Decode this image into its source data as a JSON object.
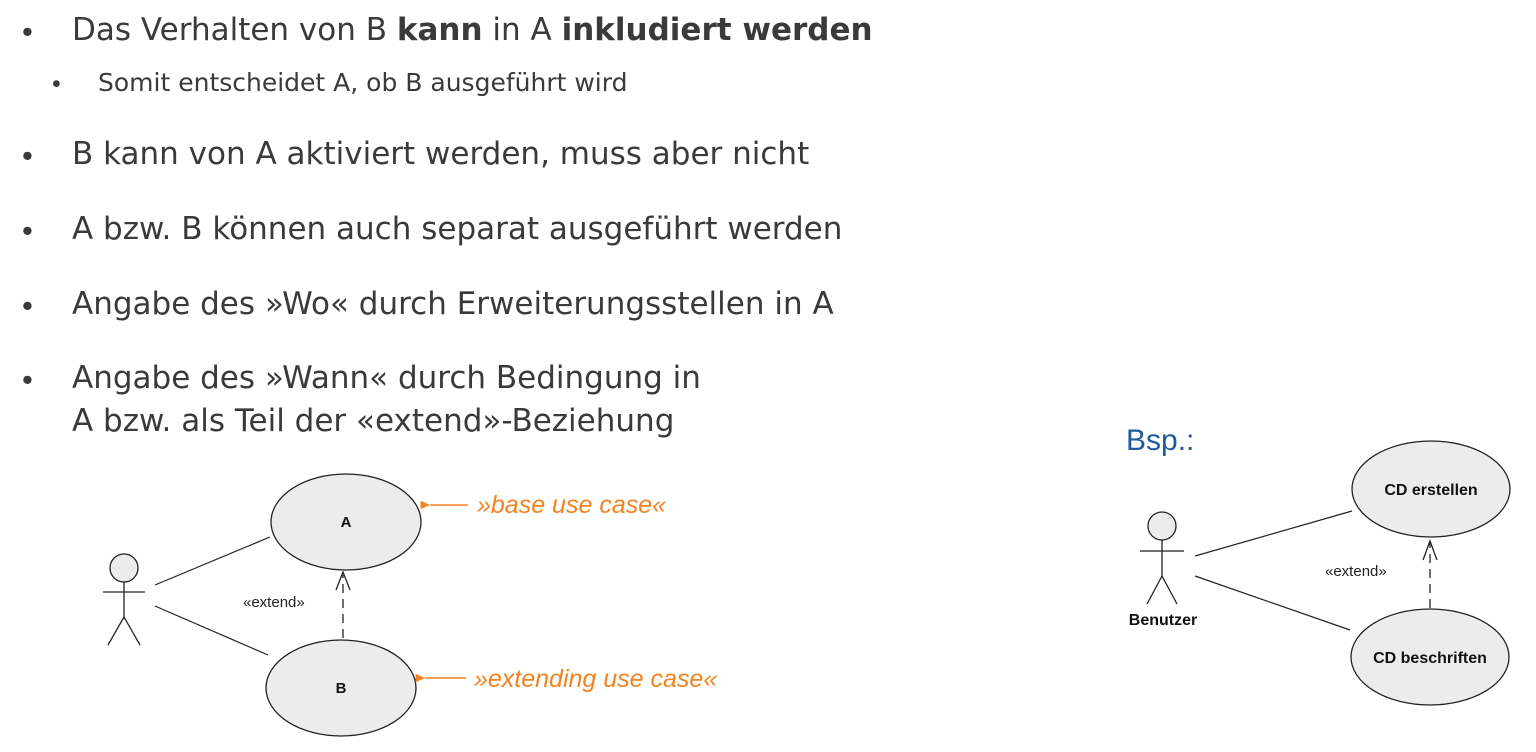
{
  "bullets": {
    "b1_pre": "Das Verhalten von B ",
    "b1_bold1": "kann",
    "b1_mid": " in A ",
    "b1_bold2": "inkludiert werden",
    "b1_sub": "Somit entscheidet A, ob B ausgeführt wird",
    "b2": "B kann von A aktiviert werden, muss aber nicht",
    "b3": "A bzw. B können auch separat ausgeführt werden",
    "b4": "Angabe des »Wo« durch Erweiterungsstellen in A",
    "b5_line1": "Angabe des »Wann« durch Bedingung in",
    "b5_line2": "A bzw. als Teil der «extend»-Beziehung",
    "bullet_char": "•"
  },
  "diagram_left": {
    "use_case_a": "A",
    "use_case_b": "B",
    "extend_label": "«extend»",
    "base_annotation": "»base use case«",
    "extending_annotation": "»extending use case«"
  },
  "diagram_right": {
    "example_label": "Bsp.:",
    "actor_label": "Benutzer",
    "use_case_top": "CD erstellen",
    "use_case_bottom": "CD beschriften",
    "extend_label": "«extend»"
  },
  "colors": {
    "text": "#3a3a3a",
    "annotation": "#f58220",
    "example_label": "#1f5a9e",
    "ellipse_fill": "#ececec",
    "line": "#222222"
  }
}
